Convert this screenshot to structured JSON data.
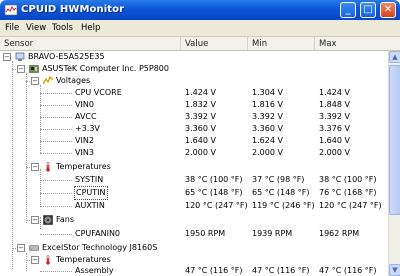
{
  "window": {
    "title": "CPUID HWMonitor"
  },
  "title_buttons": {
    "minimize": "_",
    "maximize": "□",
    "close": "✕"
  },
  "menu": [
    "File",
    "View",
    "Tools",
    "Help"
  ],
  "columns": [
    "Sensor",
    "Value",
    "Min",
    "Max"
  ],
  "rows": [
    {
      "label": "BRAVO-E5A525E35",
      "value": "",
      "min": "",
      "max": "",
      "icon": "computer-icon"
    },
    {
      "label": "ASUSTeK Computer Inc. P5P800",
      "value": "",
      "min": "",
      "max": "",
      "icon": "motherboard-icon"
    },
    {
      "label": "Voltages",
      "value": "",
      "min": "",
      "max": "",
      "icon": "voltage-icon"
    },
    {
      "label": "CPU VCORE",
      "value": "1.424 V",
      "min": "1.304 V",
      "max": "1.424 V"
    },
    {
      "label": "VIN0",
      "value": "1.832 V",
      "min": "1.816 V",
      "max": "1.848 V"
    },
    {
      "label": "AVCC",
      "value": "3.392 V",
      "min": "3.392 V",
      "max": "3.392 V"
    },
    {
      "label": "+3.3V",
      "value": "3.360 V",
      "min": "3.360 V",
      "max": "3.376 V"
    },
    {
      "label": "VIN2",
      "value": "1.640 V",
      "min": "1.624 V",
      "max": "1.640 V"
    },
    {
      "label": "VIN3",
      "value": "2.000 V",
      "min": "2.000 V",
      "max": "2.000 V"
    },
    {
      "label": "Temperatures",
      "value": "",
      "min": "",
      "max": "",
      "icon": "thermometer-icon"
    },
    {
      "label": "SYSTIN",
      "value": "38 °C  (100 °F)",
      "min": "37 °C  (98 °F)",
      "max": "38 °C  (100 °F)"
    },
    {
      "label": "CPUTIN",
      "value": "65 °C  (148 °F)",
      "min": "65 °C  (148 °F)",
      "max": "76 °C  (168 °F)"
    },
    {
      "label": "AUXTIN",
      "value": "120 °C  (247 °F)",
      "min": "119 °C  (246 °F)",
      "max": "120 °C  (247 °F)"
    },
    {
      "label": "Fans",
      "value": "",
      "min": "",
      "max": "",
      "icon": "fan-icon"
    },
    {
      "label": "CPUFANIN0",
      "value": "1950 RPM",
      "min": "1939 RPM",
      "max": "1962 RPM"
    },
    {
      "label": "ExcelStor Technology J8160S",
      "value": "",
      "min": "",
      "max": "",
      "icon": "hard-drive-icon"
    },
    {
      "label": "Temperatures",
      "value": "",
      "min": "",
      "max": "",
      "icon": "thermometer-icon"
    },
    {
      "label": "Assembly",
      "value": "47 °C  (116 °F)",
      "min": "47 °C  (116 °F)",
      "max": "47 °C  (116 °F)"
    }
  ],
  "colors": {
    "titlebar": "#0a55d8",
    "menubar": "#ece9d8",
    "thermometer": "#d42020",
    "voltage": "#e0a000"
  }
}
